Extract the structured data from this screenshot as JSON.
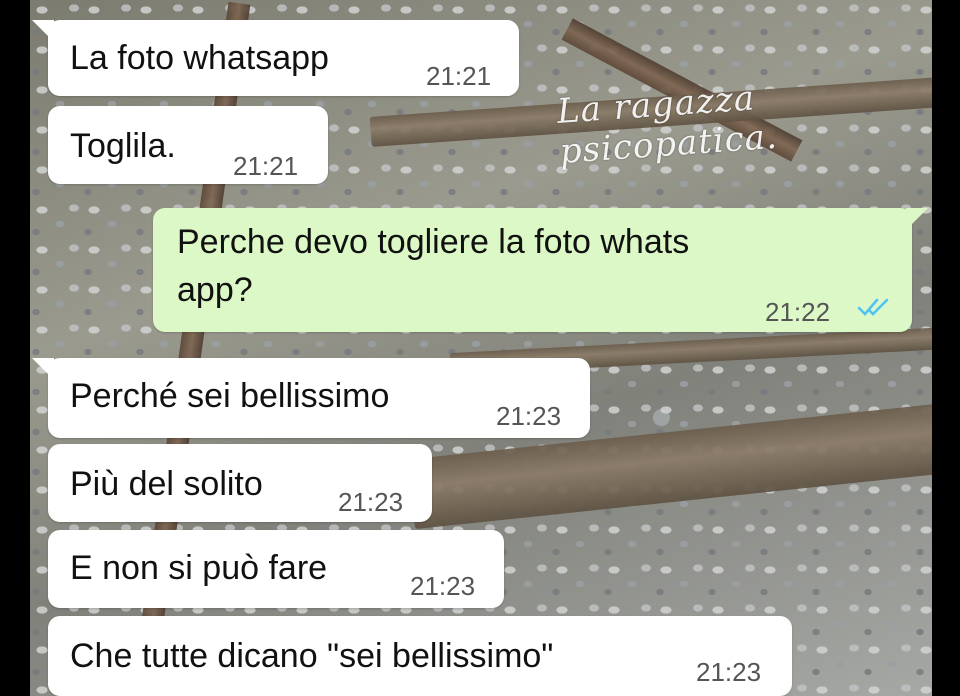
{
  "watermark": "La ragazza psicopatica.",
  "colors": {
    "incoming_bubble": "#ffffff",
    "outgoing_bubble": "#dcf8c6",
    "read_ticks": "#4fc3f7"
  },
  "messages": [
    {
      "direction": "in",
      "text": "La foto whatsapp",
      "time": "21:21"
    },
    {
      "direction": "in",
      "text": "Toglila.",
      "time": "21:21"
    },
    {
      "direction": "out",
      "text_line1": "Perche devo togliere la foto whats",
      "text_line2": "app?",
      "time": "21:22",
      "status_icon": "double-check-read-icon"
    },
    {
      "direction": "in",
      "text": "Perché sei bellissimo",
      "time": "21:23"
    },
    {
      "direction": "in",
      "text": "Più del solito",
      "time": "21:23"
    },
    {
      "direction": "in",
      "text": "E non si può fare",
      "time": "21:23"
    },
    {
      "direction": "in",
      "text": "Che tutte dicano \"sei bellissimo\"",
      "time": "21:23"
    }
  ]
}
